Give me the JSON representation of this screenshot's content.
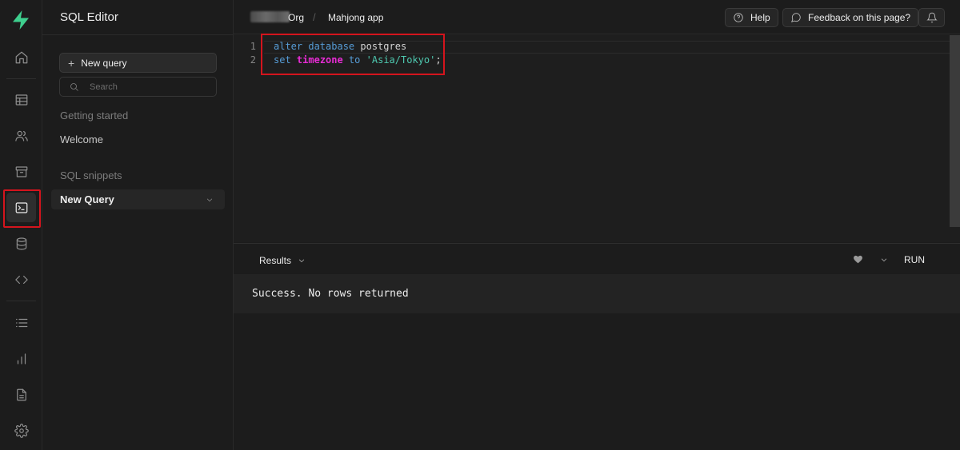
{
  "app": {
    "brand_color": "#3ecf8e",
    "highlight_color": "#d4141d"
  },
  "rail": {
    "items": [
      {
        "icon": "home-icon"
      },
      {
        "icon": "table-editor-icon"
      },
      {
        "icon": "users-icon"
      },
      {
        "icon": "storage-icon"
      },
      {
        "icon": "sql-editor-icon",
        "active": true
      },
      {
        "icon": "database-icon"
      },
      {
        "icon": "api-code-icon"
      },
      {
        "icon": "logs-list-icon"
      },
      {
        "icon": "reports-chart-icon"
      },
      {
        "icon": "docs-icon"
      },
      {
        "icon": "settings-gear-icon"
      }
    ]
  },
  "sidebar": {
    "title": "SQL Editor",
    "new_query_label": "New query",
    "search_placeholder": "Search",
    "getting_started_label": "Getting started",
    "welcome_label": "Welcome",
    "snippets_label": "SQL snippets",
    "active_snippet": "New Query"
  },
  "header": {
    "org_name": "Org",
    "project_name": "Mahjong app",
    "separator": "/",
    "help_label": "Help",
    "feedback_label": "Feedback on this page?"
  },
  "editor": {
    "lines": [
      {
        "num": "1",
        "tokens": {
          "t1": "alter",
          "t2": " ",
          "t3": "database",
          "t4": " postgres"
        }
      },
      {
        "num": "2",
        "tokens": {
          "t1": "set",
          "t2": " ",
          "t3": "timezone",
          "t4": " ",
          "t5": "to",
          "t6": " ",
          "t7": "'Asia/Tokyo'",
          "t8": ";"
        }
      }
    ]
  },
  "results": {
    "tab_label": "Results",
    "run_label": "RUN",
    "message": "Success. No rows returned"
  }
}
